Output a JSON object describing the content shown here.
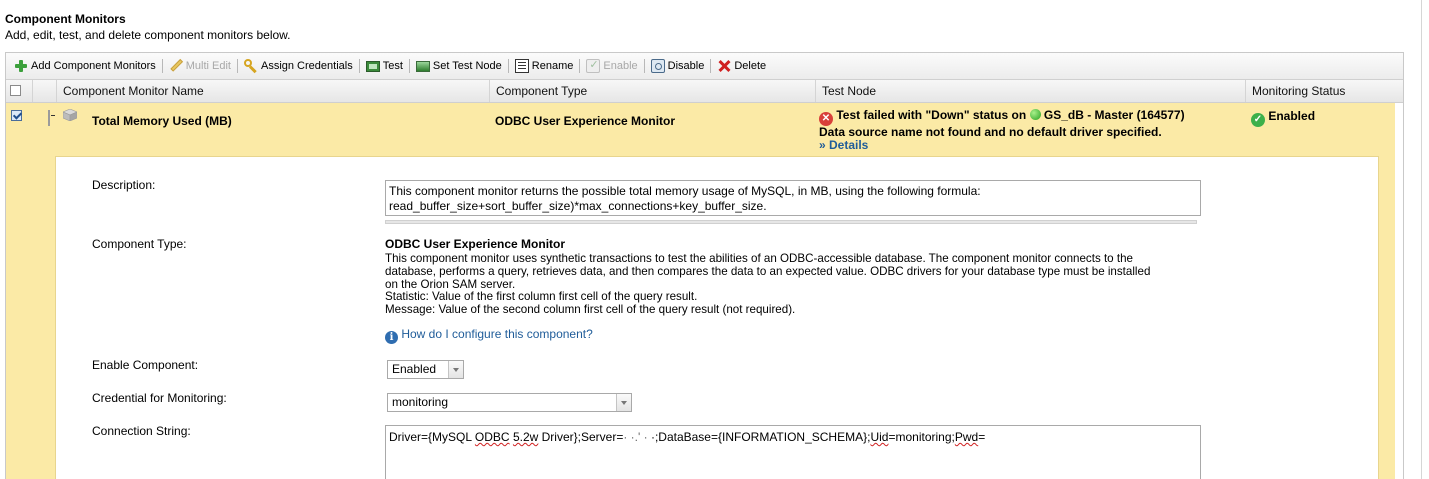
{
  "page": {
    "title": "Component Monitors",
    "subtitle": "Add, edit, test, and delete component monitors below."
  },
  "toolbar": {
    "add": "Add Component Monitors",
    "multi_edit": "Multi Edit",
    "assign_credentials": "Assign Credentials",
    "test": "Test",
    "set_test_node": "Set Test Node",
    "rename": "Rename",
    "enable": "Enable",
    "disable": "Disable",
    "delete": "Delete"
  },
  "table": {
    "columns": [
      "Component Monitor Name",
      "Component Type",
      "Test Node",
      "Monitoring Status"
    ]
  },
  "row": {
    "name": "Total Memory Used (MB)",
    "type": "ODBC User Experience Monitor",
    "test_node": {
      "status_prefix": "Test failed with \"Down\" status on",
      "node": "GS_dB - Master (164577)",
      "error": "Data source name not found and no default driver specified.",
      "details_link": "» Details"
    },
    "monitoring_status": "Enabled"
  },
  "detail": {
    "description_label": "Description:",
    "description_line1": "This component monitor returns the possible total memory usage of MySQL, in MB, using the following formula:",
    "description_line2": "read_buffer_size+sort_buffer_size)*max_connections+key_buffer_size.",
    "component_type_label": "Component Type:",
    "component_type_title": "ODBC User Experience Monitor",
    "component_type_lines": [
      "This component monitor uses synthetic transactions to test the abilities of an ODBC-accessible database. The component monitor connects to the",
      "database, performs a query, retrieves data, and then compares the data to an expected value. ODBC drivers for your database type must be installed",
      "on the Orion SAM server.",
      "Statistic: Value of the first column first cell of the query result.",
      "Message: Value of the second column first cell of the query result (not required)."
    ],
    "help_link": "How do I configure this component?",
    "enable_label": "Enable Component:",
    "enable_value": "Enabled",
    "credential_label": "Credential for Monitoring:",
    "credential_value": "monitoring",
    "connection_label": "Connection String:",
    "connection": {
      "part1": "Driver={MySQL ",
      "part2": "ODBC",
      "part3": " ",
      "part4": "5.2w",
      "part5": " Driver};Server=",
      "part6": "·  ·.'  ·",
      "part7": "  ·;DataBase={INFORMATION_SCHEMA};",
      "part8": "Uid",
      "part9": "=monitoring;",
      "part10": "Pwd",
      "part11": "="
    }
  },
  "colors": {
    "selected_row": "#fbeaa6",
    "link": "#1f5c99",
    "error_red": "#d8403a",
    "ok_green": "#3cb04a"
  }
}
